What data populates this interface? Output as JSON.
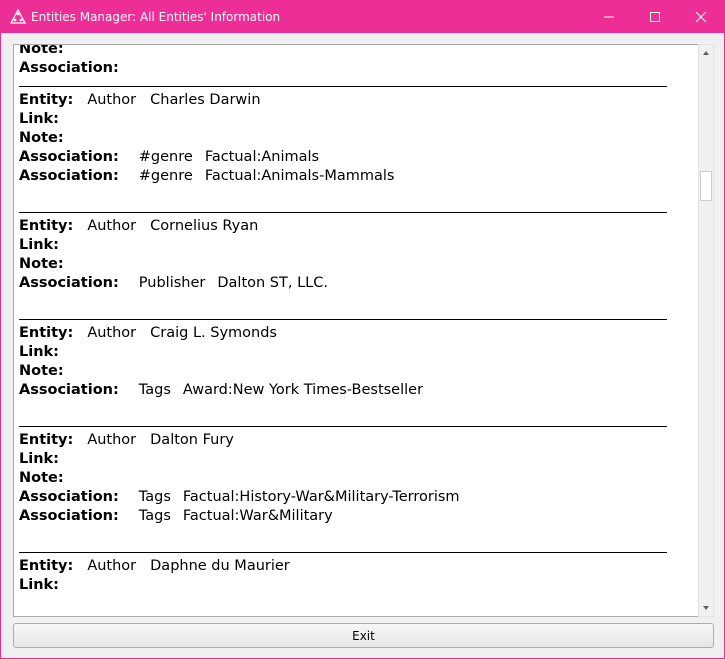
{
  "window": {
    "title": "Entities Manager:  All Entities' Information",
    "title_bar_color": "#ee2e97"
  },
  "labels": {
    "entity": "Entity:",
    "link": "Link:",
    "note": "Note:",
    "association": "Association:"
  },
  "partial_top": {
    "lines": [
      "Note:",
      "Association:"
    ]
  },
  "entries": [
    {
      "type": "Author",
      "name": "Charles Darwin",
      "associations": [
        {
          "kind": "#genre",
          "value": "Factual:Animals"
        },
        {
          "kind": "#genre",
          "value": "Factual:Animals-Mammals"
        }
      ]
    },
    {
      "type": "Author",
      "name": "Cornelius Ryan",
      "associations": [
        {
          "kind": "Publisher",
          "value": "Dalton ST, LLC."
        }
      ]
    },
    {
      "type": "Author",
      "name": "Craig L. Symonds",
      "associations": [
        {
          "kind": "Tags",
          "value": "Award:New York Times-Bestseller"
        }
      ]
    },
    {
      "type": "Author",
      "name": "Dalton Fury",
      "associations": [
        {
          "kind": "Tags",
          "value": "Factual:History-War&Military-Terrorism"
        },
        {
          "kind": "Tags",
          "value": "Factual:War&Military"
        }
      ]
    },
    {
      "type": "Author",
      "name": "Daphne du Maurier",
      "associations": []
    }
  ],
  "buttons": {
    "exit": "Exit"
  },
  "icons": {
    "app": "triangle-logo-icon",
    "minimize": "minimize-icon",
    "maximize": "maximize-icon",
    "close": "close-icon"
  }
}
